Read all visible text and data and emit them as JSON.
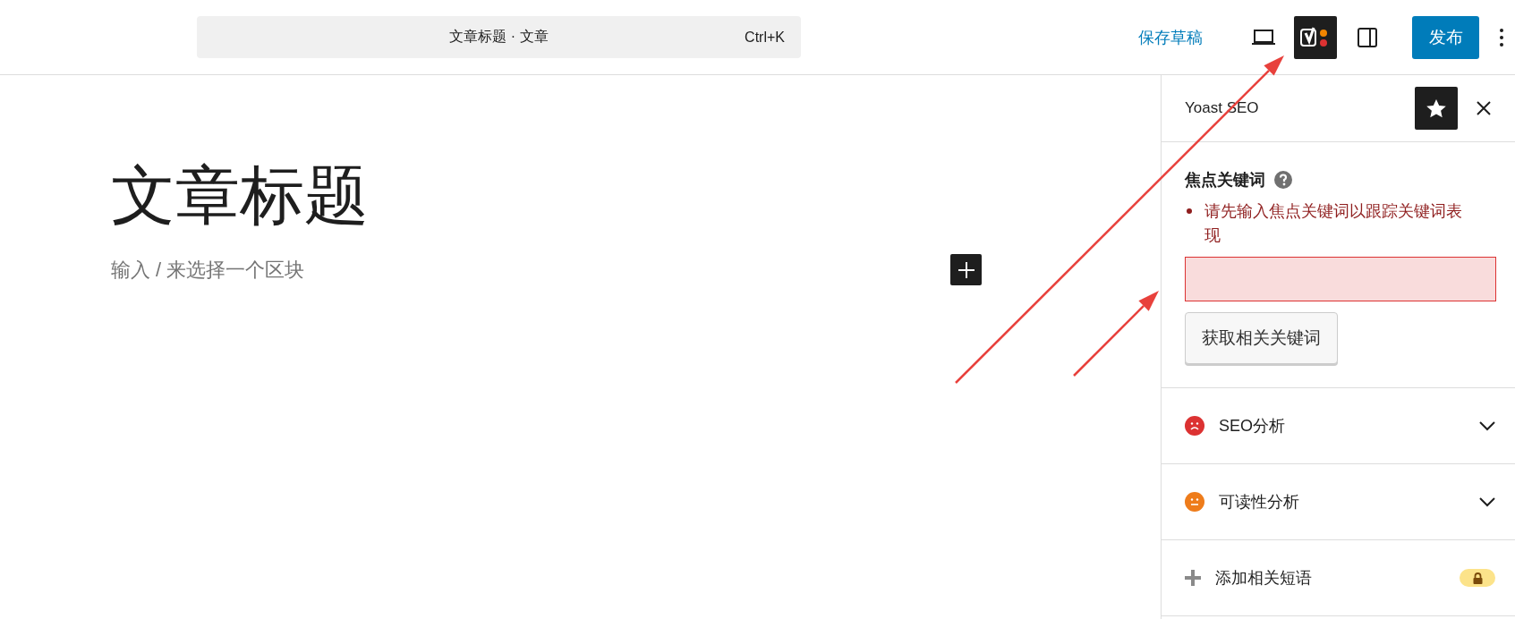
{
  "topbar": {
    "command": {
      "title": "文章标题 · 文章",
      "shortcut": "Ctrl+K"
    },
    "save_draft": "保存草稿",
    "tools": [
      {
        "kind": "preview",
        "pressed": false
      },
      {
        "kind": "yoast",
        "pressed": true
      },
      {
        "kind": "settings",
        "pressed": false
      }
    ],
    "publish": "发布"
  },
  "editor": {
    "title": "文章标题",
    "placeholder": "输入 / 来选择一个区块"
  },
  "sidebar": {
    "title": "Yoast SEO",
    "focus_keyphrase": {
      "label": "焦点关键词",
      "error": "请先输入焦点关键词以跟踪关键词表现",
      "invalid": true,
      "button": "获取相关关键词"
    },
    "sections": [
      {
        "kind": "analysis",
        "label": "SEO分析",
        "color": "#dc3232",
        "expanded": false
      },
      {
        "kind": "analysis",
        "label": "可读性分析",
        "color": "#ee7c1b",
        "expanded": false
      },
      {
        "kind": "premium",
        "label": "添加相关短语",
        "locked": true
      }
    ]
  },
  "annotations": [
    {
      "kind": "arrow"
    },
    {
      "kind": "arrow"
    }
  ]
}
